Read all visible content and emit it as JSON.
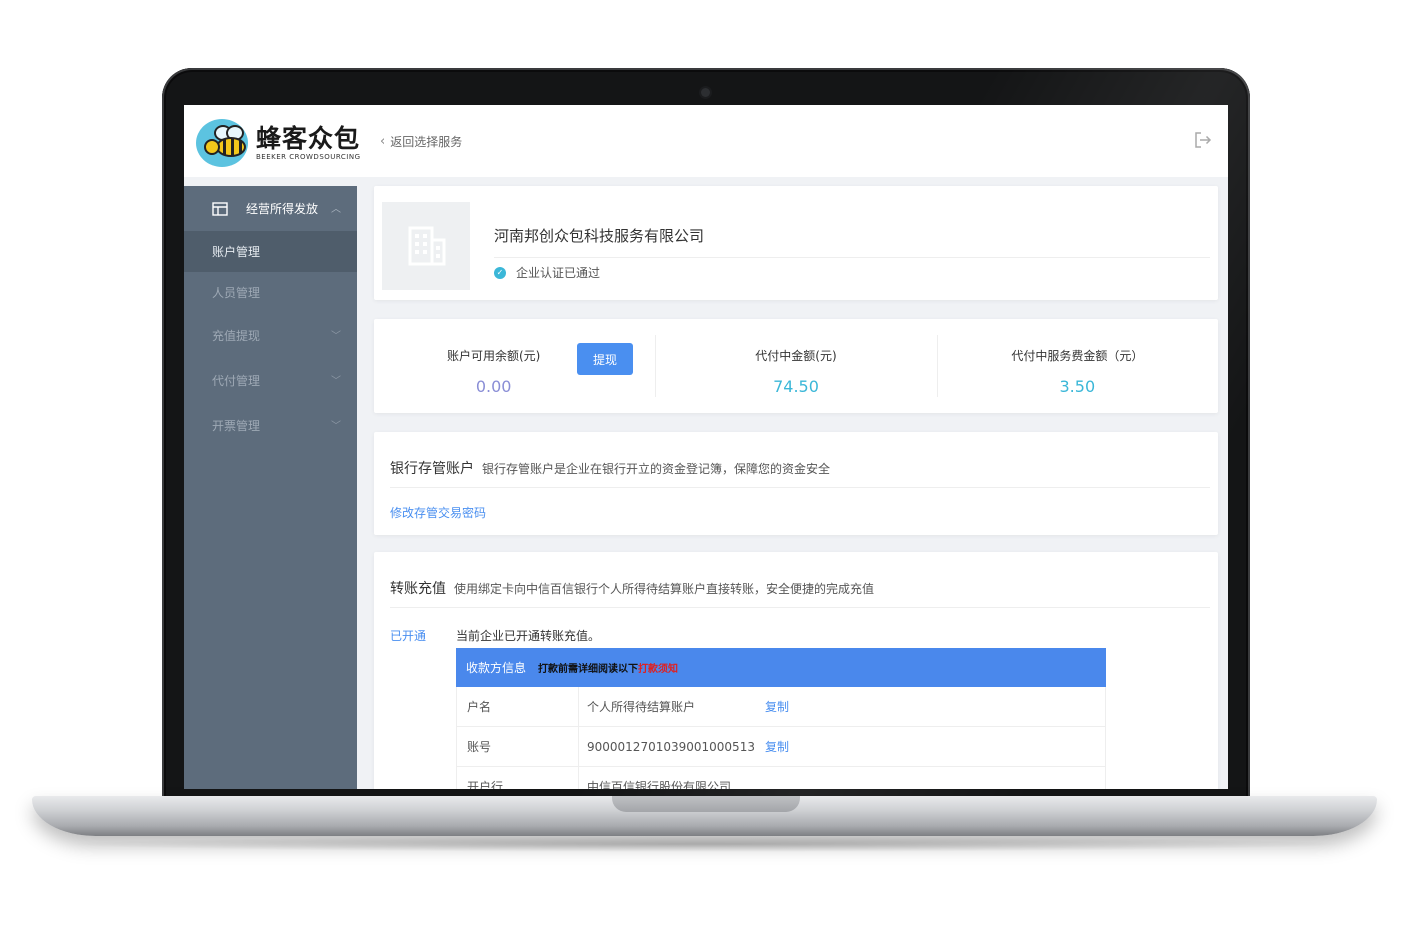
{
  "header": {
    "brand_name": "蜂客众包",
    "brand_subtitle": "BEEKER CROWDSOURCING",
    "back_label": "返回选择服务",
    "logout_icon": "logout-icon"
  },
  "sidebar": {
    "group_label": "经营所得发放",
    "items": [
      {
        "label": "账户管理",
        "active": true
      },
      {
        "label": "人员管理"
      },
      {
        "label": "充值提现"
      },
      {
        "label": "代付管理"
      },
      {
        "label": "开票管理"
      }
    ]
  },
  "company": {
    "name": "河南邦创众包科技服务有限公司",
    "verify_text": "企业认证已通过"
  },
  "balance": {
    "available_label": "账户可用余额(元)",
    "available_value": "0.00",
    "withdraw_label": "提现",
    "paying_label": "代付中金额(元)",
    "paying_value": "74.50",
    "service_fee_label": "代付中服务费金额（元）",
    "service_fee_value": "3.50"
  },
  "bank": {
    "title": "银行存管账户",
    "desc": "银行存管账户是企业在银行开立的资金登记簿，保障您的资金安全",
    "link": "修改存管交易密码"
  },
  "transfer": {
    "title": "转账充值",
    "desc": "使用绑定卡向中信百信银行个人所得待结算账户直接转账，安全便捷的完成充值",
    "status": "已开通",
    "status_text": "当前企业已开通转账充值。",
    "table_title": "收款方信息",
    "table_note": "打款前需详细阅读以下",
    "table_warn": "打款须知",
    "rows": [
      {
        "key": "户名",
        "value": "个人所得待结算账户",
        "copy": "复制"
      },
      {
        "key": "账号",
        "value": "9000012701039001000513",
        "copy": "复制"
      },
      {
        "key": "开户行",
        "value": "中信百信银行股份有限公司"
      }
    ]
  },
  "colors": {
    "accent": "#4a8ff0",
    "sidebar": "#5d6c7c",
    "value_teal": "#3bb7d8",
    "value_purple": "#8a8ed6"
  }
}
